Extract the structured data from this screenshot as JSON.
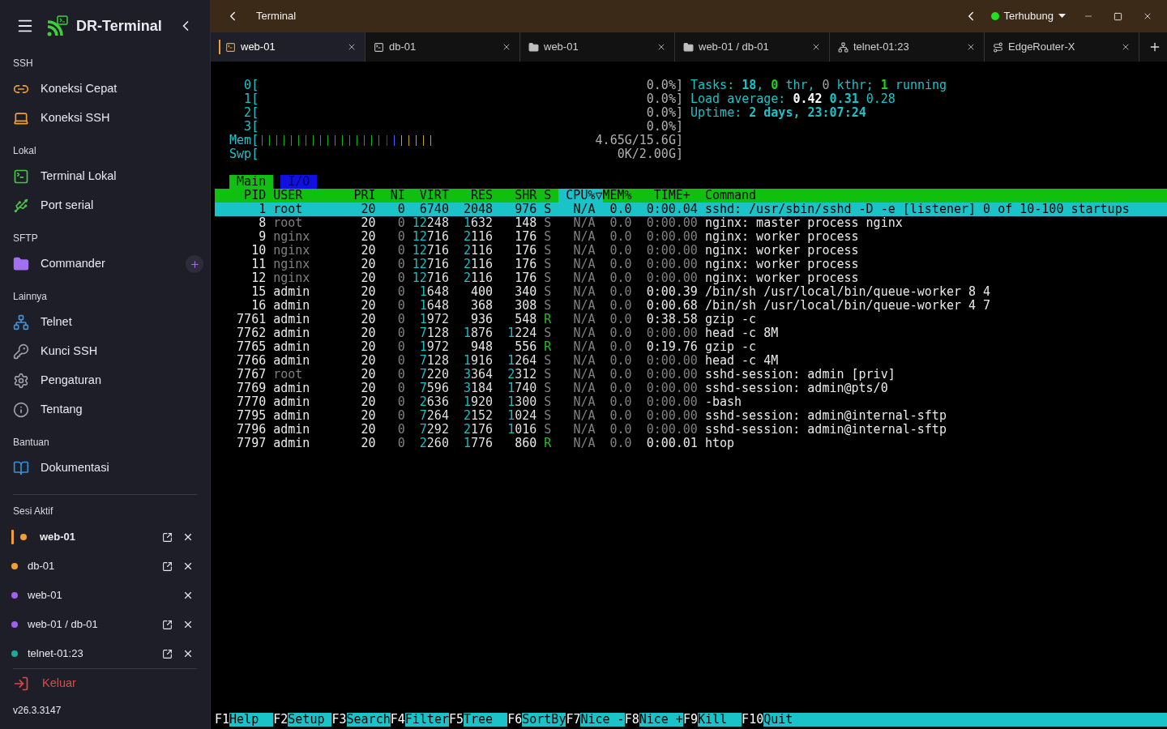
{
  "sidebar": {
    "app_name": "DR-Terminal",
    "sections": [
      {
        "title": "SSH",
        "items": [
          {
            "label": "Koneksi Cepat",
            "kind": "link"
          },
          {
            "label": "Koneksi SSH",
            "kind": "laptop"
          }
        ]
      },
      {
        "title": "Lokal",
        "items": [
          {
            "label": "Terminal Lokal",
            "kind": "terminal"
          },
          {
            "label": "Port serial",
            "kind": "plug"
          }
        ]
      },
      {
        "title": "SFTP",
        "items": [
          {
            "label": "Commander",
            "kind": "folder",
            "addable": true
          }
        ]
      },
      {
        "title": "Lainnya",
        "items": [
          {
            "label": "Telnet",
            "kind": "network"
          },
          {
            "label": "Kunci SSH",
            "kind": "key"
          },
          {
            "label": "Pengaturan",
            "kind": "gear"
          },
          {
            "label": "Tentang",
            "kind": "info"
          }
        ]
      },
      {
        "title": "Bantuan",
        "items": [
          {
            "label": "Dokumentasi",
            "kind": "book"
          }
        ]
      }
    ],
    "sessions_title": "Sesi Aktif",
    "sessions": [
      {
        "label": "web-01",
        "color": "#f0a030",
        "selected": true,
        "detachable": true
      },
      {
        "label": "db-01",
        "color": "#f0a030",
        "selected": false,
        "detachable": true
      },
      {
        "label": "web-01",
        "color": "#a060f0",
        "selected": false,
        "detachable": false
      },
      {
        "label": "web-01 / db-01",
        "color": "#a060f0",
        "selected": false,
        "detachable": true
      },
      {
        "label": "telnet-01:23",
        "color": "#20a898",
        "selected": false,
        "detachable": true
      }
    ],
    "logout": "Keluar",
    "version": "v26.3.3147"
  },
  "titlebar": {
    "title": "Terminal",
    "status": "Terhubung",
    "connected": true
  },
  "tabs": [
    {
      "label": "web-01",
      "kind": "terminal",
      "selected": true
    },
    {
      "label": "db-01",
      "kind": "terminal",
      "selected": false
    },
    {
      "label": "web-01",
      "kind": "folder",
      "selected": false
    },
    {
      "label": "web-01 / db-01",
      "kind": "folder",
      "selected": false
    },
    {
      "label": "telnet-01:23",
      "kind": "network",
      "selected": false
    },
    {
      "label": "EdgeRouter-X",
      "kind": "route",
      "selected": false
    }
  ],
  "terminal": {
    "meters": [
      {
        "label": "0[",
        "value": "0.0%]"
      },
      {
        "label": "1[",
        "value": "0.0%]"
      },
      {
        "label": "2[",
        "value": "0.0%]"
      },
      {
        "label": "3[",
        "value": "0.0%]"
      },
      {
        "label": "Mem[",
        "value": "4.65G/15.6G]",
        "kind": "memory"
      },
      {
        "label": "Swp[",
        "value": "0K/2.00G]"
      }
    ],
    "summary": [
      [
        {
          "text": "Tasks: ",
          "kind": "label"
        },
        {
          "text": "18",
          "kind": "value"
        },
        {
          "text": ", ",
          "kind": "label"
        },
        {
          "text": "0",
          "kind": "good"
        },
        {
          "text": " thr, ",
          "kind": "label"
        },
        {
          "text": "0",
          "kind": "dim"
        },
        {
          "text": " kthr; ",
          "kind": "label"
        },
        {
          "text": "1",
          "kind": "good"
        },
        {
          "text": " running",
          "kind": "label"
        }
      ],
      [
        {
          "text": "Load average: ",
          "kind": "label"
        },
        {
          "text": "0.42 ",
          "kind": "strong"
        },
        {
          "text": "0.31",
          "kind": "value"
        },
        {
          "text": " 0.28",
          "kind": "label"
        }
      ],
      [
        {
          "text": "Uptime: ",
          "kind": "label"
        },
        {
          "text": "2 days, 23:07:24",
          "kind": "value"
        }
      ]
    ],
    "views": [
      {
        "label": "Main",
        "selected": true
      },
      {
        "label": "I/O",
        "selected": false
      }
    ],
    "columns": [
      {
        "label": "PID",
        "sorted": false
      },
      {
        "label": "USER",
        "sorted": false
      },
      {
        "label": "PRI",
        "sorted": false
      },
      {
        "label": "NI",
        "sorted": false
      },
      {
        "label": "VIRT",
        "sorted": false
      },
      {
        "label": "RES",
        "sorted": false
      },
      {
        "label": "SHR",
        "sorted": false
      },
      {
        "label": "S",
        "sorted": false
      },
      {
        "label": "CPU%▽",
        "sorted": true
      },
      {
        "label": "MEM%",
        "sorted": false
      },
      {
        "label": "TIME+",
        "sorted": false
      },
      {
        "label": "Command",
        "sorted": false
      }
    ],
    "processes": [
      {
        "pid": "1",
        "user": "root",
        "pri": "20",
        "ni": "0",
        "virt": "6740",
        "res": "2048",
        "shr": "976",
        "state": "S",
        "cpu": "N/A",
        "mem": "0.0",
        "time": "0:00.04",
        "command": "sshd: /usr/sbin/sshd -D -e [listener] 0 of 10-100 startups",
        "selected": true
      },
      {
        "pid": "8",
        "user": "root",
        "pri": "20",
        "ni": "0",
        "virt": "12248",
        "res": "1632",
        "shr": "148",
        "state": "S",
        "cpu": "N/A",
        "mem": "0.0",
        "time": "0:00.00",
        "command": "nginx: master process nginx",
        "selected": false,
        "user_dimmed": true,
        "time_dimmed": true,
        "running": false
      },
      {
        "pid": "9",
        "user": "nginx",
        "pri": "20",
        "ni": "0",
        "virt": "12716",
        "res": "2116",
        "shr": "176",
        "state": "S",
        "cpu": "N/A",
        "mem": "0.0",
        "time": "0:00.00",
        "command": "nginx: worker process",
        "selected": false,
        "user_dimmed": true,
        "time_dimmed": true,
        "running": false
      },
      {
        "pid": "10",
        "user": "nginx",
        "pri": "20",
        "ni": "0",
        "virt": "12716",
        "res": "2116",
        "shr": "176",
        "state": "S",
        "cpu": "N/A",
        "mem": "0.0",
        "time": "0:00.00",
        "command": "nginx: worker process",
        "selected": false,
        "user_dimmed": true,
        "time_dimmed": true,
        "running": false
      },
      {
        "pid": "11",
        "user": "nginx",
        "pri": "20",
        "ni": "0",
        "virt": "12716",
        "res": "2116",
        "shr": "176",
        "state": "S",
        "cpu": "N/A",
        "mem": "0.0",
        "time": "0:00.00",
        "command": "nginx: worker process",
        "selected": false,
        "user_dimmed": true,
        "time_dimmed": true,
        "running": false
      },
      {
        "pid": "12",
        "user": "nginx",
        "pri": "20",
        "ni": "0",
        "virt": "12716",
        "res": "2116",
        "shr": "176",
        "state": "S",
        "cpu": "N/A",
        "mem": "0.0",
        "time": "0:00.00",
        "command": "nginx: worker process",
        "selected": false,
        "user_dimmed": true,
        "time_dimmed": true,
        "running": false
      },
      {
        "pid": "15",
        "user": "admin",
        "pri": "20",
        "ni": "0",
        "virt": "1648",
        "res": "400",
        "shr": "340",
        "state": "S",
        "cpu": "N/A",
        "mem": "0.0",
        "time": "0:00.39",
        "command": "/bin/sh /usr/local/bin/queue-worker 8 4",
        "selected": false,
        "user_dimmed": false,
        "time_dimmed": false,
        "running": false
      },
      {
        "pid": "16",
        "user": "admin",
        "pri": "20",
        "ni": "0",
        "virt": "1648",
        "res": "368",
        "shr": "308",
        "state": "S",
        "cpu": "N/A",
        "mem": "0.0",
        "time": "0:00.68",
        "command": "/bin/sh /usr/local/bin/queue-worker 4 7",
        "selected": false,
        "user_dimmed": false,
        "time_dimmed": false,
        "running": false
      },
      {
        "pid": "7761",
        "user": "admin",
        "pri": "20",
        "ni": "0",
        "virt": "1972",
        "res": "936",
        "shr": "548",
        "state": "R",
        "cpu": "N/A",
        "mem": "0.0",
        "time": "0:38.58",
        "command": "gzip -c",
        "selected": false,
        "user_dimmed": false,
        "time_dimmed": false,
        "running": true
      },
      {
        "pid": "7762",
        "user": "admin",
        "pri": "20",
        "ni": "0",
        "virt": "7128",
        "res": "1876",
        "shr": "1224",
        "state": "S",
        "cpu": "N/A",
        "mem": "0.0",
        "time": "0:00.00",
        "command": "head -c 8M",
        "selected": false,
        "user_dimmed": false,
        "time_dimmed": true,
        "running": false
      },
      {
        "pid": "7765",
        "user": "admin",
        "pri": "20",
        "ni": "0",
        "virt": "1972",
        "res": "948",
        "shr": "556",
        "state": "R",
        "cpu": "N/A",
        "mem": "0.0",
        "time": "0:19.76",
        "command": "gzip -c",
        "selected": false,
        "user_dimmed": false,
        "time_dimmed": false,
        "running": true
      },
      {
        "pid": "7766",
        "user": "admin",
        "pri": "20",
        "ni": "0",
        "virt": "7128",
        "res": "1916",
        "shr": "1264",
        "state": "S",
        "cpu": "N/A",
        "mem": "0.0",
        "time": "0:00.00",
        "command": "head -c 4M",
        "selected": false,
        "user_dimmed": false,
        "time_dimmed": true,
        "running": false
      },
      {
        "pid": "7767",
        "user": "root",
        "pri": "20",
        "ni": "0",
        "virt": "7220",
        "res": "3364",
        "shr": "2312",
        "state": "S",
        "cpu": "N/A",
        "mem": "0.0",
        "time": "0:00.00",
        "command": "sshd-session: admin [priv]",
        "selected": false,
        "user_dimmed": true,
        "time_dimmed": true,
        "running": false
      },
      {
        "pid": "7769",
        "user": "admin",
        "pri": "20",
        "ni": "0",
        "virt": "7596",
        "res": "3184",
        "shr": "1740",
        "state": "S",
        "cpu": "N/A",
        "mem": "0.0",
        "time": "0:00.00",
        "command": "sshd-session: admin@pts/0",
        "selected": false,
        "user_dimmed": false,
        "time_dimmed": true,
        "running": false
      },
      {
        "pid": "7770",
        "user": "admin",
        "pri": "20",
        "ni": "0",
        "virt": "2636",
        "res": "1920",
        "shr": "1300",
        "state": "S",
        "cpu": "N/A",
        "mem": "0.0",
        "time": "0:00.00",
        "command": "-bash",
        "selected": false,
        "user_dimmed": false,
        "time_dimmed": true,
        "running": false
      },
      {
        "pid": "7795",
        "user": "admin",
        "pri": "20",
        "ni": "0",
        "virt": "7264",
        "res": "2152",
        "shr": "1024",
        "state": "S",
        "cpu": "N/A",
        "mem": "0.0",
        "time": "0:00.00",
        "command": "sshd-session: admin@internal-sftp",
        "selected": false,
        "user_dimmed": false,
        "time_dimmed": true,
        "running": false
      },
      {
        "pid": "7796",
        "user": "admin",
        "pri": "20",
        "ni": "0",
        "virt": "7292",
        "res": "2176",
        "shr": "1016",
        "state": "S",
        "cpu": "N/A",
        "mem": "0.0",
        "time": "0:00.00",
        "command": "sshd-session: admin@internal-sftp",
        "selected": false,
        "user_dimmed": false,
        "time_dimmed": true,
        "running": false
      },
      {
        "pid": "7797",
        "user": "admin",
        "pri": "20",
        "ni": "0",
        "virt": "2260",
        "res": "1776",
        "shr": "860",
        "state": "R",
        "cpu": "N/A",
        "mem": "0.0",
        "time": "0:00.01",
        "command": "htop",
        "selected": false,
        "user_dimmed": false,
        "time_dimmed": false,
        "running": true
      }
    ],
    "function_keys": [
      {
        "key": "F1",
        "label": "Help"
      },
      {
        "key": "F2",
        "label": "Setup"
      },
      {
        "key": "F3",
        "label": "Search"
      },
      {
        "key": "F4",
        "label": "Filter"
      },
      {
        "key": "F5",
        "label": "Tree"
      },
      {
        "key": "F6",
        "label": "SortBy"
      },
      {
        "key": "F7",
        "label": "Nice -"
      },
      {
        "key": "F8",
        "label": "Nice +"
      },
      {
        "key": "F9",
        "label": "Kill"
      },
      {
        "key": "F10",
        "label": "Quit"
      }
    ]
  }
}
